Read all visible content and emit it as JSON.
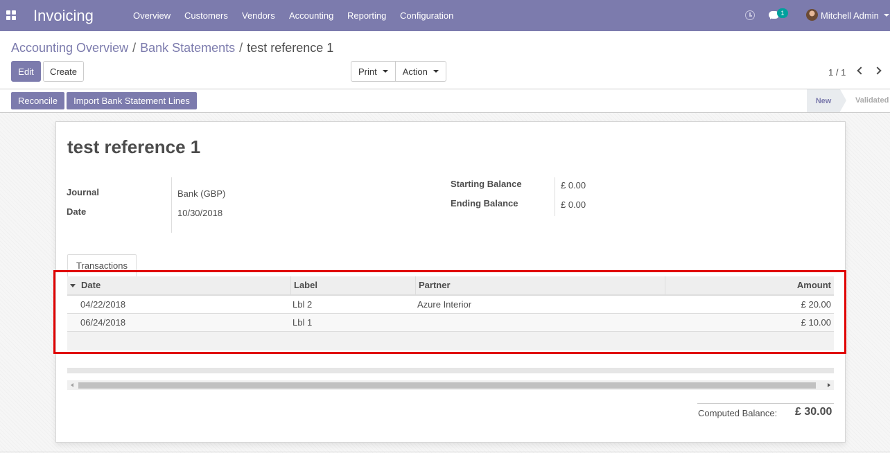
{
  "navbar": {
    "app_name": "Invoicing",
    "menu": [
      "Overview",
      "Customers",
      "Vendors",
      "Accounting",
      "Reporting",
      "Configuration"
    ],
    "chat_count": "1",
    "user_name": "Mitchell Admin",
    "bg_color": "#7c7bad"
  },
  "breadcrumb": {
    "items": [
      "Accounting Overview",
      "Bank Statements"
    ],
    "current": "test reference 1"
  },
  "buttons": {
    "edit": "Edit",
    "create": "Create",
    "print": "Print",
    "action": "Action"
  },
  "pager": {
    "value": "1 / 1"
  },
  "statusbar": {
    "reconcile": "Reconcile",
    "import_lines": "Import Bank Statement Lines",
    "stages": [
      "New",
      "Validated"
    ],
    "active_stage": "New"
  },
  "record": {
    "title": "test reference 1",
    "journal_label": "Journal",
    "journal": "Bank (GBP)",
    "date_label": "Date",
    "date": "10/30/2018",
    "starting_balance_label": "Starting Balance",
    "starting_balance": "£ 0.00",
    "ending_balance_label": "Ending Balance",
    "ending_balance": "£ 0.00"
  },
  "tabs": [
    "Transactions"
  ],
  "table": {
    "columns": [
      "Date",
      "Label",
      "Partner",
      "Amount"
    ],
    "rows": [
      {
        "date": "04/22/2018",
        "label": "Lbl 2",
        "partner": "Azure Interior",
        "amount": "£ 20.00"
      },
      {
        "date": "06/24/2018",
        "label": "Lbl 1",
        "partner": "",
        "amount": "£ 10.00"
      }
    ]
  },
  "total": {
    "label": "Computed Balance:",
    "value": "£ 30.00"
  }
}
